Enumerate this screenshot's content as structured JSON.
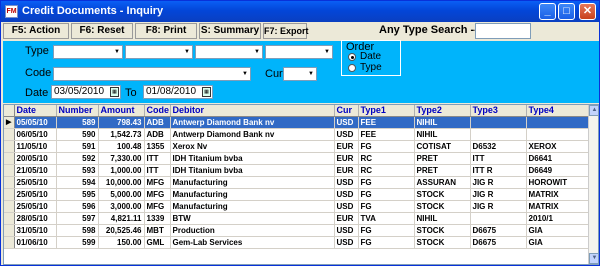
{
  "window": {
    "title": "Credit Documents - Inquiry"
  },
  "toolbar": {
    "action": "F5: Action",
    "reset": "F6: Reset",
    "print": "F8: Print",
    "summary": "S: Summary",
    "export": "F7: Export",
    "search_label": "Any Type Search -->",
    "search_value": ""
  },
  "filters": {
    "type_label": "Type",
    "code_label": "Code",
    "cur_label": "Cur",
    "date_label": "Date",
    "to_label": "To",
    "date_from": "03/05/2010",
    "date_to": "01/08/2010",
    "order": {
      "legend": "Order",
      "date": "Date",
      "type": "Type",
      "selected": "Date"
    }
  },
  "table": {
    "columns": [
      "Date",
      "Number",
      "Amount",
      "Code",
      "Debitor",
      "Cur",
      "Type1",
      "Type2",
      "Type3",
      "Type4"
    ],
    "rows": [
      [
        "05/05/10",
        "589",
        "798.43",
        "ADB",
        "Antwerp Diamond Bank nv",
        "USD",
        "FEE",
        "NIHIL",
        "",
        ""
      ],
      [
        "06/05/10",
        "590",
        "1,542.73",
        "ADB",
        "Antwerp Diamond Bank nv",
        "USD",
        "FEE",
        "NIHIL",
        "",
        ""
      ],
      [
        "11/05/10",
        "591",
        "100.48",
        "1355",
        "Xerox Nv",
        "EUR",
        "FG",
        "COTISAT",
        "D6532",
        "XEROX"
      ],
      [
        "20/05/10",
        "592",
        "7,330.00",
        "ITT",
        "IDH Titanium bvba",
        "EUR",
        "RC",
        "PRET",
        "ITT",
        "D6641"
      ],
      [
        "21/05/10",
        "593",
        "1,000.00",
        "ITT",
        "IDH Titanium bvba",
        "EUR",
        "RC",
        "PRET",
        "ITT R",
        "D6649"
      ],
      [
        "25/05/10",
        "594",
        "10,000.00",
        "MFG",
        "Manufacturing",
        "USD",
        "FG",
        "ASSURAN",
        "JIG R",
        "HOROWIT"
      ],
      [
        "25/05/10",
        "595",
        "5,000.00",
        "MFG",
        "Manufacturing",
        "USD",
        "FG",
        "STOCK",
        "JIG R",
        "MATRIX"
      ],
      [
        "25/05/10",
        "596",
        "3,000.00",
        "MFG",
        "Manufacturing",
        "USD",
        "FG",
        "STOCK",
        "JIG R",
        "MATRIX"
      ],
      [
        "28/05/10",
        "597",
        "4,821.11",
        "1339",
        "BTW",
        "EUR",
        "TVA",
        "NIHIL",
        "",
        "2010/1"
      ],
      [
        "31/05/10",
        "598",
        "20,525.46",
        "MBT",
        "Production",
        "USD",
        "FG",
        "STOCK",
        "D6675",
        "GIA"
      ],
      [
        "01/06/10",
        "599",
        "150.00",
        "GML",
        "Gem-Lab Services",
        "USD",
        "FG",
        "STOCK",
        "D6675",
        "GIA"
      ]
    ],
    "selected_row": 0
  },
  "colors": {
    "filter_bg": "#00b4fb",
    "header_text": "#0000c0",
    "selection": "#316ac5"
  }
}
